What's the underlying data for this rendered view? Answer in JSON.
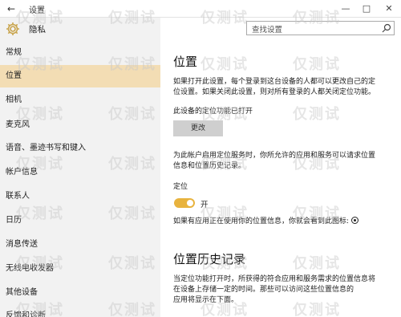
{
  "window": {
    "title": "设置",
    "back_glyph": "←",
    "min_glyph": "—",
    "max_glyph": "□",
    "close_glyph": "✕"
  },
  "sidebar": {
    "header": "隐私",
    "items": [
      {
        "label": "常规",
        "active": false
      },
      {
        "label": "位置",
        "active": true
      },
      {
        "label": "相机",
        "active": false
      },
      {
        "label": "麦克风",
        "active": false
      },
      {
        "label": "语音、墨迹书写和键入",
        "active": false
      },
      {
        "label": "帐户信息",
        "active": false
      },
      {
        "label": "联系人",
        "active": false
      },
      {
        "label": "日历",
        "active": false
      },
      {
        "label": "消息传送",
        "active": false
      },
      {
        "label": "无线电收发器",
        "active": false
      },
      {
        "label": "其他设备",
        "active": false
      },
      {
        "label": "反馈和诊断",
        "active": false
      }
    ]
  },
  "search": {
    "placeholder": "查找设置",
    "icon": "search-icon"
  },
  "content": {
    "title": "位置",
    "intro_line1": "如果打开此设置，每个登录到这台设备的人都可以更改自己的定",
    "intro_line2": "位设置。如果关闭此设置，则对所有登录的人都关闭定位功能。",
    "status_text": "此设备的定位功能已打开",
    "change_button": "更改",
    "desc_line1": "为此帐户启用定位服务时，你所允许的应用和服务可以请求位置",
    "desc_line2": "信息和位置历史记录。",
    "location_label": "定位",
    "toggle_state": "开",
    "toggle_on": true,
    "indicator_text": "如果有应用正在使用你的位置信息，你就会看到此图标:",
    "history_title": "位置历史记录",
    "history_line1": "当定位功能打开时，所获得的符合应用和服务需求的位置信息将",
    "history_line2": "在设备上存储一定的时间。那些可以访问这些位置信息的",
    "history_line3": "应用将显示在下面。"
  },
  "watermark": "仅测试",
  "colors": {
    "accent": "#e8b33e",
    "active_bg": "#f3ddb4",
    "sidebar_bg": "#f2f2f2"
  }
}
